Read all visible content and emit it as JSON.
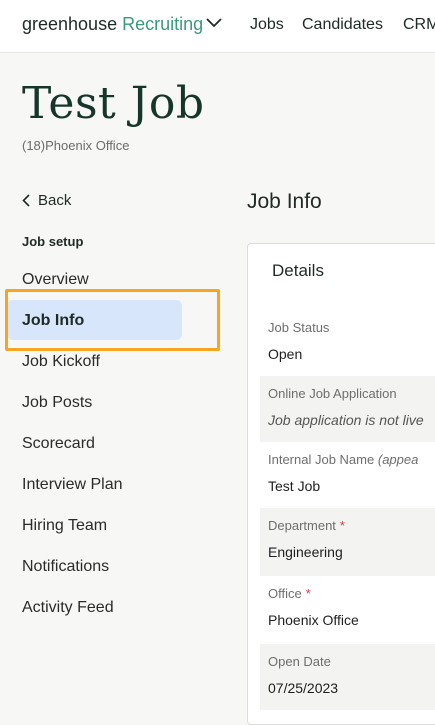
{
  "topnav": {
    "brand_primary": "greenhouse",
    "brand_secondary": "Recruiting",
    "links": [
      "Jobs",
      "Candidates",
      "CRM"
    ]
  },
  "header": {
    "title": "Test Job",
    "subtitle": "(18)Phoenix Office"
  },
  "sidebar": {
    "back_label": "Back",
    "section_label": "Job setup",
    "items": [
      {
        "label": "Overview",
        "active": false
      },
      {
        "label": "Job Info",
        "active": true
      },
      {
        "label": "Job Kickoff",
        "active": false
      },
      {
        "label": "Job Posts",
        "active": false
      },
      {
        "label": "Scorecard",
        "active": false
      },
      {
        "label": "Interview Plan",
        "active": false
      },
      {
        "label": "Hiring Team",
        "active": false
      },
      {
        "label": "Notifications",
        "active": false
      },
      {
        "label": "Activity Feed",
        "active": false
      }
    ]
  },
  "main": {
    "title": "Job Info",
    "panel_title": "Details",
    "fields": [
      {
        "label": "Job Status",
        "value": "Open"
      },
      {
        "label": "Online Job Application",
        "value": "Job application is not live"
      },
      {
        "label": "Internal Job Name",
        "label_note": "(appea",
        "value": "Test Job"
      },
      {
        "label": "Department",
        "required": "*",
        "value": "Engineering"
      },
      {
        "label": "Office",
        "required": "*",
        "value": "Phoenix Office"
      },
      {
        "label": "Open Date",
        "value": "07/25/2023"
      }
    ]
  },
  "colors": {
    "brand_green": "#3a9b78",
    "active_bg": "#d7e6fb",
    "highlight": "#f6a623",
    "required": "#d6394b"
  }
}
